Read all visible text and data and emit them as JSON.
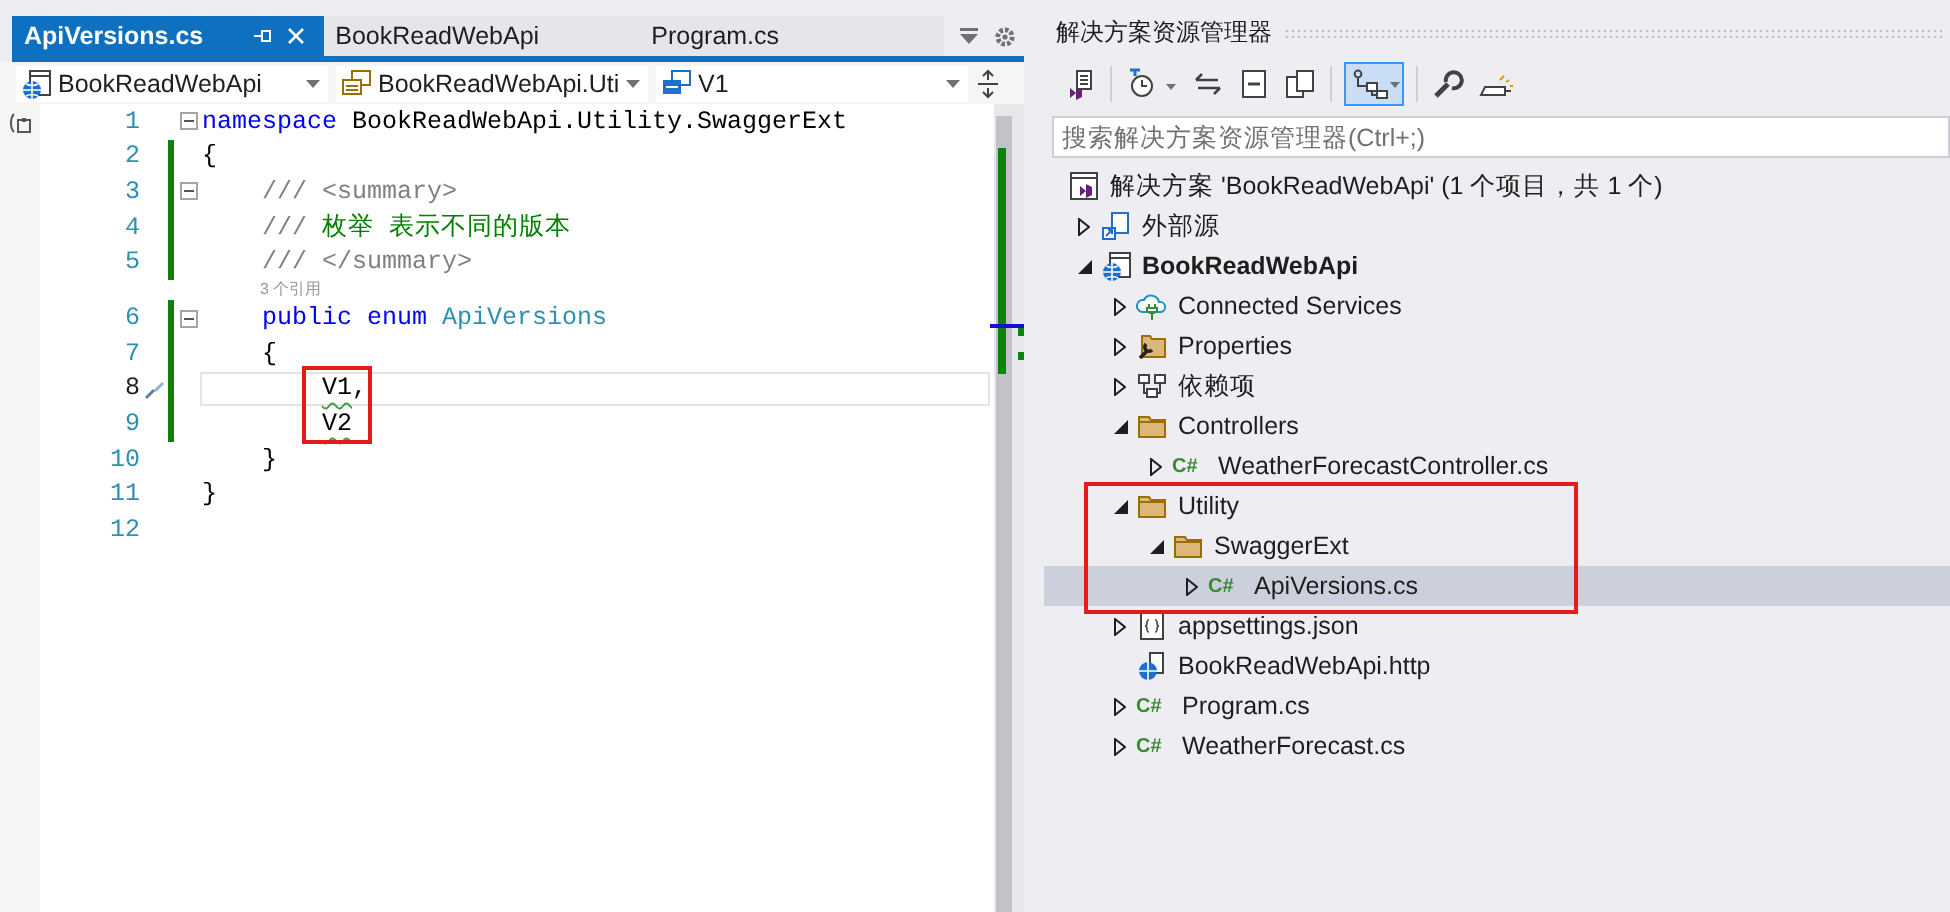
{
  "editor": {
    "tabs": [
      {
        "label": "ApiVersions.cs",
        "selected": true
      },
      {
        "label": "BookReadWebApi",
        "selected": false
      },
      {
        "label": "Program.cs",
        "selected": false
      }
    ],
    "nav": [
      {
        "text": "BookReadWebApi",
        "kind": "project"
      },
      {
        "text": "BookReadWebApi.Uti",
        "kind": "namespace"
      },
      {
        "text": "V1",
        "kind": "member"
      }
    ],
    "lines": [
      {
        "kind": "code",
        "number": "1",
        "foldable": true,
        "tokens": [
          {
            "text": "namespace",
            "kind": "keyword"
          },
          {
            "text": " BookReadWebApi.Utility.SwaggerExt",
            "kind": "plain"
          }
        ]
      },
      {
        "kind": "code",
        "number": "2",
        "changed": true,
        "tokens": [
          {
            "text": "{",
            "kind": "plain"
          }
        ]
      },
      {
        "kind": "code",
        "number": "3",
        "changed": true,
        "foldable": true,
        "tokens": [
          {
            "text": "    /// <summary>",
            "kind": "doc"
          }
        ]
      },
      {
        "kind": "code",
        "number": "4",
        "changed": true,
        "tokens": [
          {
            "text": "    ///",
            "kind": "doc"
          },
          {
            "text": " 枚举 表示不同的版本",
            "kind": "comment"
          }
        ]
      },
      {
        "kind": "code",
        "number": "5",
        "changed": true,
        "tokens": [
          {
            "text": "    /// </summary>",
            "kind": "doc"
          }
        ]
      },
      {
        "kind": "codelens",
        "text": "3 个引用"
      },
      {
        "kind": "code",
        "number": "6",
        "changed": true,
        "foldable": true,
        "tokens": [
          {
            "text": "    public",
            "kind": "keyword"
          },
          {
            "text": " enum",
            "kind": "keyword"
          },
          {
            "text": " ApiVersions",
            "kind": "type"
          }
        ]
      },
      {
        "kind": "code",
        "number": "7",
        "changed": true,
        "tokens": [
          {
            "text": "    {",
            "kind": "plain"
          }
        ]
      },
      {
        "kind": "code",
        "number": "8",
        "changed": true,
        "current": true,
        "tokens": [
          {
            "text": "        V1",
            "kind": "plain",
            "squiggle": true,
            "boxed": true
          },
          {
            "text": ",",
            "kind": "plain"
          }
        ]
      },
      {
        "kind": "code",
        "number": "9",
        "changed": true,
        "tokens": [
          {
            "text": "        V2",
            "kind": "plain",
            "squiggle": true,
            "boxed": true
          }
        ]
      },
      {
        "kind": "code",
        "number": "10",
        "tokens": [
          {
            "text": "    }",
            "kind": "plain"
          }
        ]
      },
      {
        "kind": "code",
        "number": "11",
        "tokens": [
          {
            "text": "}",
            "kind": "plain"
          }
        ]
      },
      {
        "kind": "code",
        "number": "12"
      }
    ]
  },
  "explorer": {
    "title": "解决方案资源管理器",
    "toolbar": [
      {
        "kind": "home",
        "pressed": false
      },
      {
        "kind": "history",
        "pressed": false
      },
      {
        "kind": "sync",
        "pressed": false
      },
      {
        "kind": "collapse",
        "pressed": false
      },
      {
        "kind": "copies",
        "pressed": false
      },
      {
        "kind": "tree",
        "pressed": true
      },
      {
        "kind": "wrench",
        "pressed": false
      },
      {
        "kind": "preview",
        "pressed": false
      }
    ],
    "search": {
      "placeholder": "搜索解决方案资源管理器(Ctrl+;)"
    },
    "tree": [
      {
        "label": "解决方案 'BookReadWebApi' (1 个项目，共 1 个)",
        "kind": "solution",
        "selected": false,
        "children": [
          {
            "label": "外部源",
            "kind": "external",
            "expanded": false,
            "selected": false
          },
          {
            "label": "BookReadWebApi",
            "kind": "project",
            "expanded": true,
            "selected": false,
            "children": [
              {
                "label": "Connected Services",
                "kind": "connected",
                "expanded": false,
                "selected": false
              },
              {
                "label": "Properties",
                "kind": "properties",
                "expanded": false,
                "selected": false
              },
              {
                "label": "依赖项",
                "kind": "dependencies",
                "expanded": false,
                "selected": false
              },
              {
                "label": "Controllers",
                "kind": "folder",
                "expanded": true,
                "selected": false,
                "children": [
                  {
                    "label": "WeatherForecastController.cs",
                    "kind": "csharp",
                    "icon_text": "C#",
                    "expanded": false,
                    "selected": false
                  }
                ]
              },
              {
                "label": "Utility",
                "kind": "folder",
                "expanded": true,
                "selected": false,
                "boxed": true,
                "children": [
                  {
                    "label": "SwaggerExt",
                    "kind": "folder",
                    "expanded": true,
                    "selected": false,
                    "boxed": true,
                    "children": [
                      {
                        "label": "ApiVersions.cs",
                        "kind": "csharp",
                        "icon_text": "C#",
                        "expanded": false,
                        "selected": true,
                        "boxed": true
                      }
                    ]
                  }
                ]
              },
              {
                "label": "appsettings.json",
                "kind": "json",
                "expanded": false,
                "selected": false
              },
              {
                "label": "BookReadWebApi.http",
                "kind": "http",
                "selected": false
              },
              {
                "label": "Program.cs",
                "kind": "csharp",
                "icon_text": "C#",
                "expanded": false,
                "selected": false
              },
              {
                "label": "WeatherForecast.cs",
                "kind": "csharp",
                "icon_text": "C#",
                "expanded": false,
                "selected": false
              }
            ]
          }
        ]
      }
    ]
  }
}
